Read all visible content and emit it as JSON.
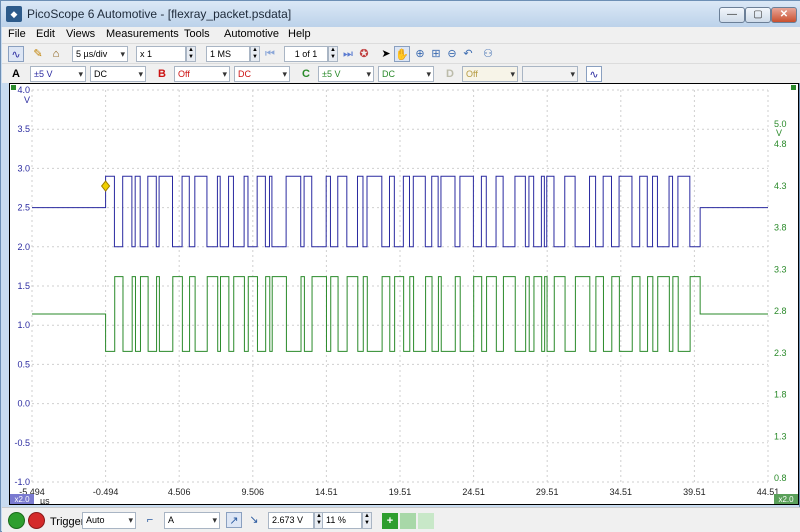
{
  "window": {
    "title": "PicoScope 6 Automotive - [flexray_packet.psdata]",
    "minimize_label": "—",
    "maximize_label": "▢",
    "close_label": "✕"
  },
  "menu": {
    "items": [
      "File",
      "Edit",
      "Views",
      "Measurements",
      "Tools",
      "Automotive",
      "Help"
    ]
  },
  "toolbar": {
    "timebase": "5 µs/div",
    "zoom": "x 1",
    "samples": "1 MS",
    "page": "1 of 1"
  },
  "channels": {
    "a": {
      "label": "A",
      "range": "±5 V",
      "coupling": "DC",
      "color": "#2a2aa0"
    },
    "b": {
      "label": "B",
      "range": "Off",
      "coupling": "DC",
      "color": "#cc1111"
    },
    "c": {
      "label": "C",
      "range": "±5 V",
      "coupling": "DC",
      "color": "#2a8a2a"
    },
    "d": {
      "label": "D",
      "range": "Off",
      "coupling": ""
    }
  },
  "chart_data": {
    "type": "line",
    "x_unit": "µs",
    "x_ticks": [
      "-5.494",
      "-0.494",
      "4.506",
      "9.506",
      "14.51",
      "19.51",
      "24.51",
      "29.51",
      "34.51",
      "39.51",
      "44.51"
    ],
    "xlim": [
      -5.494,
      44.51
    ],
    "left_axis": {
      "unit": "V",
      "color": "#2a2aa0",
      "ticks": [
        "4.0",
        "3.5",
        "3.0",
        "2.5",
        "2.0",
        "1.5",
        "1.0",
        "0.5",
        "0.0",
        "-0.5",
        "-1.0"
      ],
      "ylim": [
        -1.0,
        4.0
      ],
      "zoom": "x2.0"
    },
    "right_axis": {
      "unit": "V",
      "color": "#2a8a2a",
      "ticks": [
        "5.0",
        "4.8",
        "4.3",
        "3.8",
        "3.3",
        "2.8",
        "2.3",
        "1.8",
        "1.3",
        "0.8"
      ],
      "ylim": [
        0.8,
        5.0
      ],
      "zoom": "x2.0"
    },
    "series": [
      {
        "axis": "left",
        "color": "#2a2aa0",
        "idle": 2.5,
        "high": 2.9,
        "low": 2.0
      },
      {
        "axis": "right",
        "color": "#2a8a2a",
        "idle": 2.6,
        "high": 3.0,
        "low": 2.2
      }
    ],
    "trigger_time": -0.494,
    "burst_end": 39.9,
    "trigger_level_v": 2.673,
    "grid": true
  },
  "statusbar": {
    "trigger_label": "Trigger",
    "trigger_mode": "Auto",
    "trigger_channel": "A",
    "threshold": "2.673 V",
    "pre_trigger": "11 %"
  }
}
